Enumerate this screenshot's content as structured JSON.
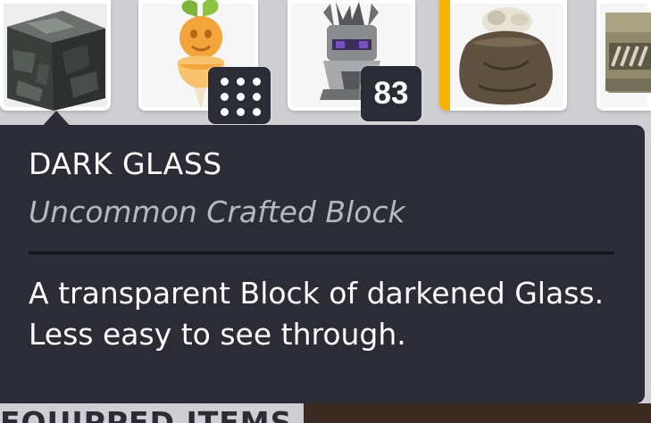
{
  "inventory": {
    "slots": [
      {
        "icon": "stone-block-icon"
      },
      {
        "icon": "carrot-spirit-icon"
      },
      {
        "icon": "horned-helmet-icon"
      },
      {
        "icon": "sack-icon"
      },
      {
        "icon": "metal-crate-icon"
      }
    ],
    "grid_badge_icon": "grid-dots-icon",
    "quantity": "83"
  },
  "tooltip": {
    "title": "DARK GLASS",
    "subtitle": "Uncommon Crafted Block",
    "description": "A transparent Block of darkened Glass. Less easy to see through."
  },
  "equipped_section": {
    "label": "EQUIPPED ITEMS"
  },
  "colors": {
    "tooltip_bg": "#2b2c35",
    "badge_bg": "#2a2c36",
    "slot_bg": "#f6f6f7",
    "page_bg": "#cfcfd3",
    "subtitle_text": "#b7b7c0",
    "highlight_bar": "#f2b400"
  }
}
